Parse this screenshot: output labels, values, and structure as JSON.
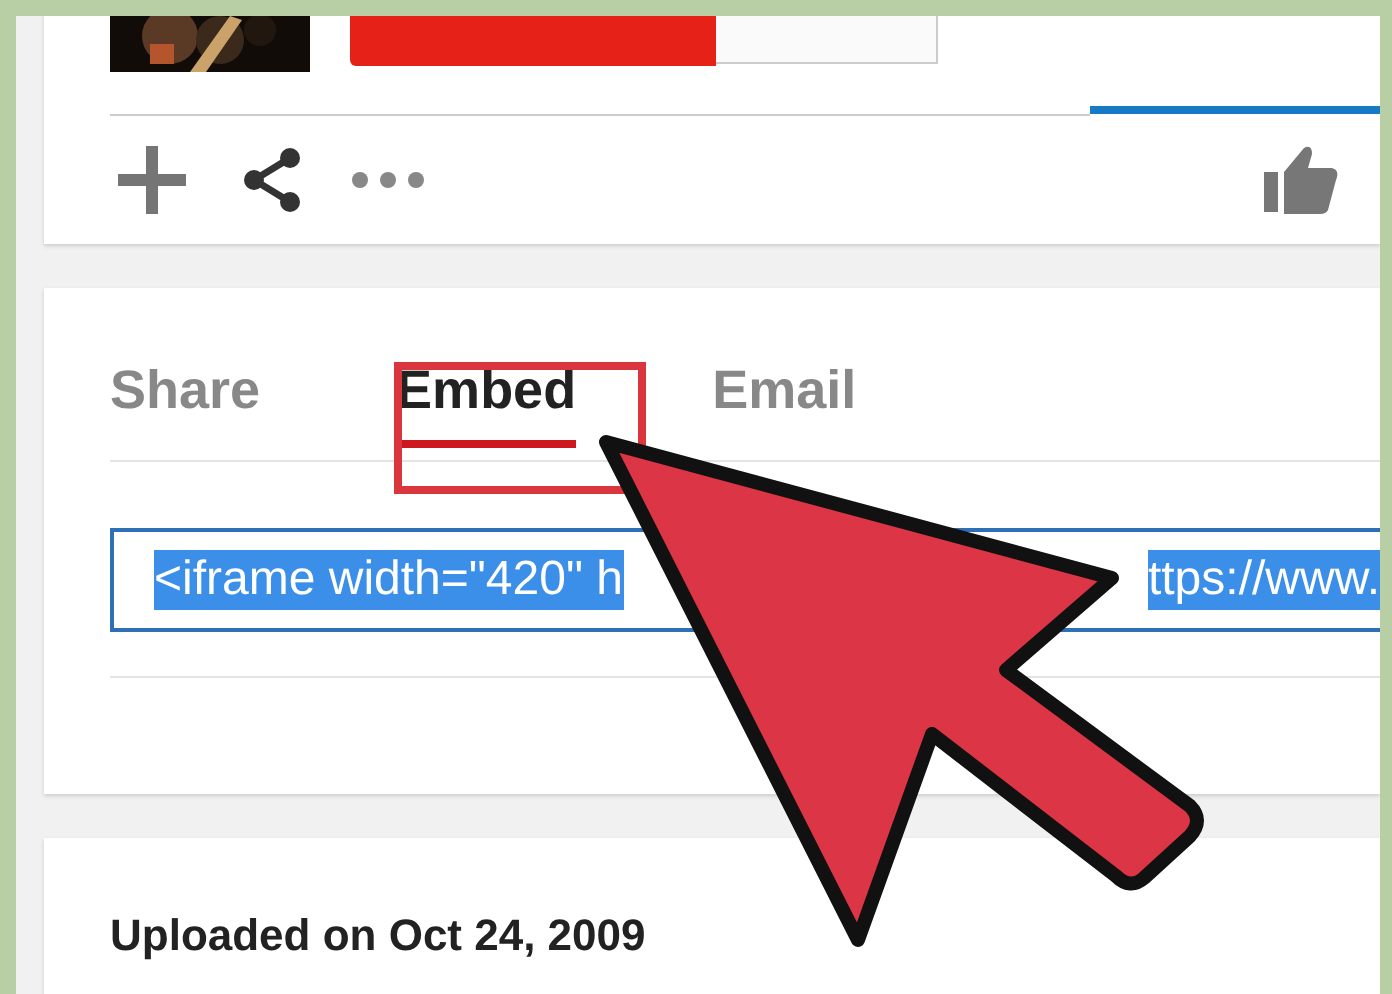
{
  "share_panel": {
    "tabs": [
      {
        "label": "Share",
        "selected": false
      },
      {
        "label": "Embed",
        "selected": true
      },
      {
        "label": "Email",
        "selected": false
      }
    ],
    "embed_code": {
      "value_parts": [
        "<iframe width=\"420\" h",
        "ttps://www."
      ],
      "selected": true
    }
  },
  "details": {
    "uploaded": "Uploaded on Oct 24, 2009"
  }
}
